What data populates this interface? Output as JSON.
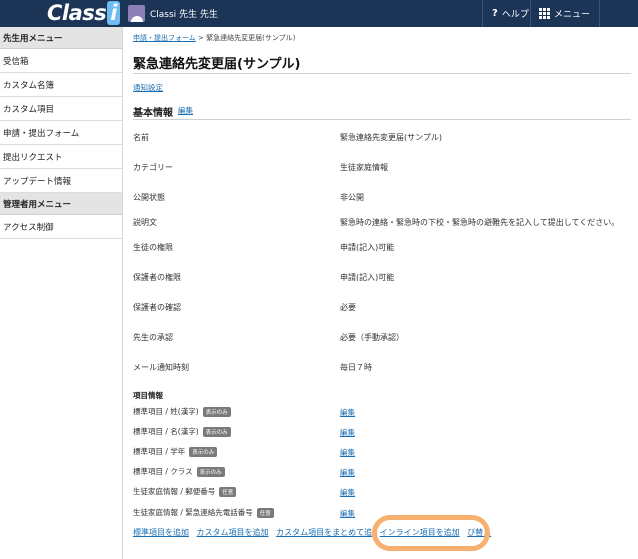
{
  "header": {
    "logo_text": "Class",
    "logo_accent": "i",
    "user_name": "Classi 先生 先生",
    "help_label": "ヘルプ",
    "menu_label": "メニュー"
  },
  "sidebar": {
    "teacher_heading": "先生用メニュー",
    "teacher_items": [
      "受信箱",
      "カスタム名簿",
      "カスタム項目",
      "申請・提出フォーム",
      "提出リクエスト",
      "アップデート情報"
    ],
    "admin_heading": "管理者用メニュー",
    "admin_items": [
      "アクセス制御"
    ]
  },
  "main": {
    "breadcrumb_link": "申請・提出フォーム",
    "breadcrumb_sep": " > ",
    "breadcrumb_current": "緊急連絡先変更届(サンプル)",
    "title": "緊急連絡先変更届(サンプル)",
    "notify_link": "通知設定",
    "basic_info": "基本情報",
    "edit_label": "編集",
    "fields": [
      {
        "label": "名前",
        "value": "緊急連絡先変更届(サンプル)"
      },
      {
        "label": "カテゴリー",
        "value": "生徒家庭情報"
      },
      {
        "label": "公開状態",
        "value": "非公開"
      },
      {
        "label": "説明文",
        "value": "緊急時の連絡・緊急時の下校・緊急時の避難先を記入して提出してください。"
      },
      {
        "label": "生徒の権限",
        "value": "申請(記入)可能"
      },
      {
        "label": "保護者の権限",
        "value": "申請(記入)可能"
      },
      {
        "label": "保護者の確認",
        "value": "必要"
      },
      {
        "label": "先生の承認",
        "value": "必要（手動承認）"
      },
      {
        "label": "メール通知時刻",
        "value": "毎日７時"
      }
    ],
    "items_title": "項目情報",
    "items": [
      {
        "label": "標準項目 / 姓(漢字)",
        "badge": "表示のみ",
        "edit": "編集"
      },
      {
        "label": "標準項目 / 名(漢字)",
        "badge": "表示のみ",
        "edit": "編集"
      },
      {
        "label": "標準項目 / 学年",
        "badge": "表示のみ",
        "edit": "編集"
      },
      {
        "label": "標準項目 / クラス",
        "badge": "表示のみ",
        "edit": "編集"
      },
      {
        "label": "生徒家庭情報 / 郵便番号",
        "badge": "任意",
        "edit": "編集"
      },
      {
        "label": "生徒家庭情報 / 緊急連絡先電話番号",
        "badge": "任意",
        "edit": "編集"
      }
    ],
    "actions": {
      "add_standard": "標準項目を追加",
      "add_custom": "カスタム項目を追加",
      "add_custom_bulk": "カスタム項目をまとめて追",
      "add_inline": "インライン項目を追加",
      "reorder": "び替え"
    }
  },
  "colors": {
    "header_bg": "#1c3556",
    "link": "#1a6fb5",
    "highlight": "#f7b070"
  }
}
